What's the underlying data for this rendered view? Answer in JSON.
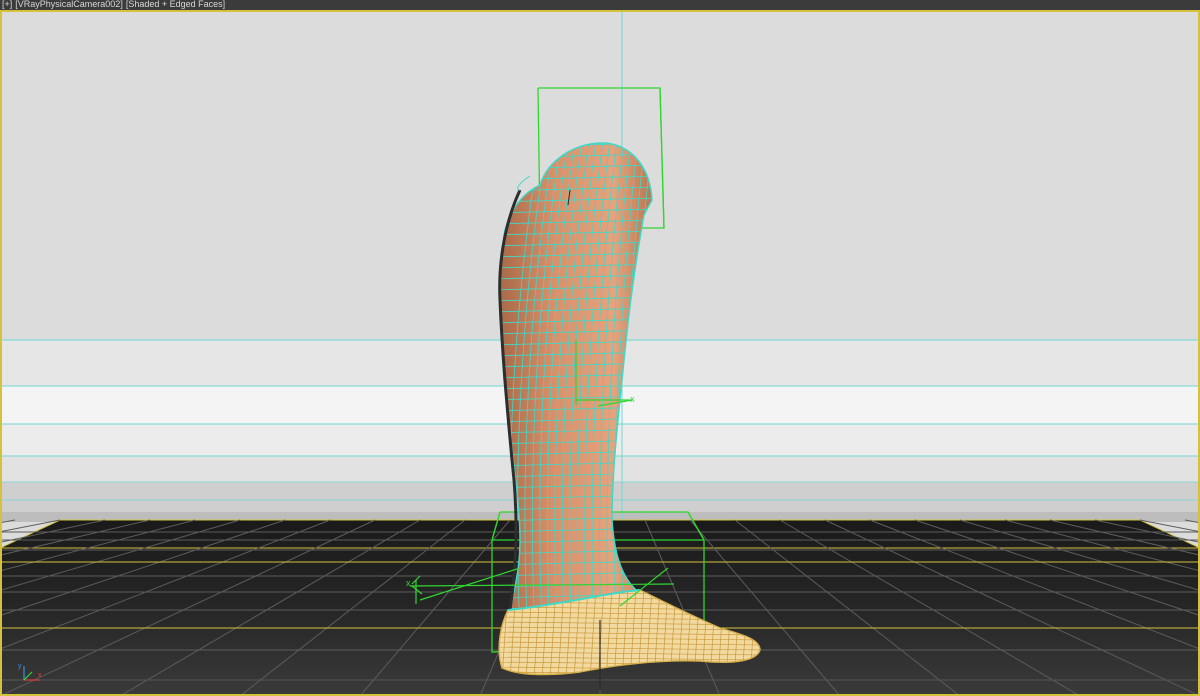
{
  "viewport": {
    "label_menu": "[+]",
    "label_camera": "[VRayPhysicalCamera002]",
    "label_shading": "[Shaded + Edged Faces]"
  },
  "scene": {
    "background_color": "#dcdcdc",
    "floor_color": "#1c1c1c",
    "grid_color": "#6a6a6a",
    "selection_box_color": "#30d630",
    "skin_color": "#d9906a",
    "wire_color": "#3fd9c8",
    "foot_wire_color": "#d8b14a",
    "foot_fill_color": "#f2d9a0",
    "frame_color": "#d4c23c"
  },
  "axis_gizmo": {
    "x_label": "x",
    "y_label": "y"
  }
}
